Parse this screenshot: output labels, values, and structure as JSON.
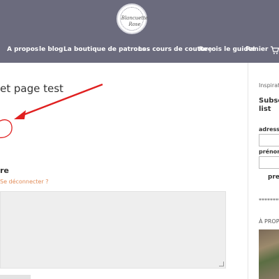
{
  "logo": {
    "line1": "Blancuette",
    "line2": "Rose"
  },
  "nav": [
    {
      "label": "A propos"
    },
    {
      "label": "le blog"
    },
    {
      "label": "La boutique de patrons",
      "chevron": "›"
    },
    {
      "label": "Les cours de couture"
    },
    {
      "label": "Reçois le guide!"
    },
    {
      "label": "Panier"
    }
  ],
  "cart_icon": "shopping-cart-icon",
  "main": {
    "title": "et page test",
    "comment_heading": "re",
    "logout_link": "Se déconnecter ?"
  },
  "sidebar": {
    "inspiration": "Inspirati",
    "subscribe": [
      "Subscr",
      "list"
    ],
    "email_label": "adresse",
    "firstname_label": "prénom",
    "submit_label": "pren",
    "stars": "*********",
    "about": "À PROPO"
  },
  "colors": {
    "header": "#6b6b7d",
    "accent": "#e08a55",
    "annotation": "#e02020"
  }
}
